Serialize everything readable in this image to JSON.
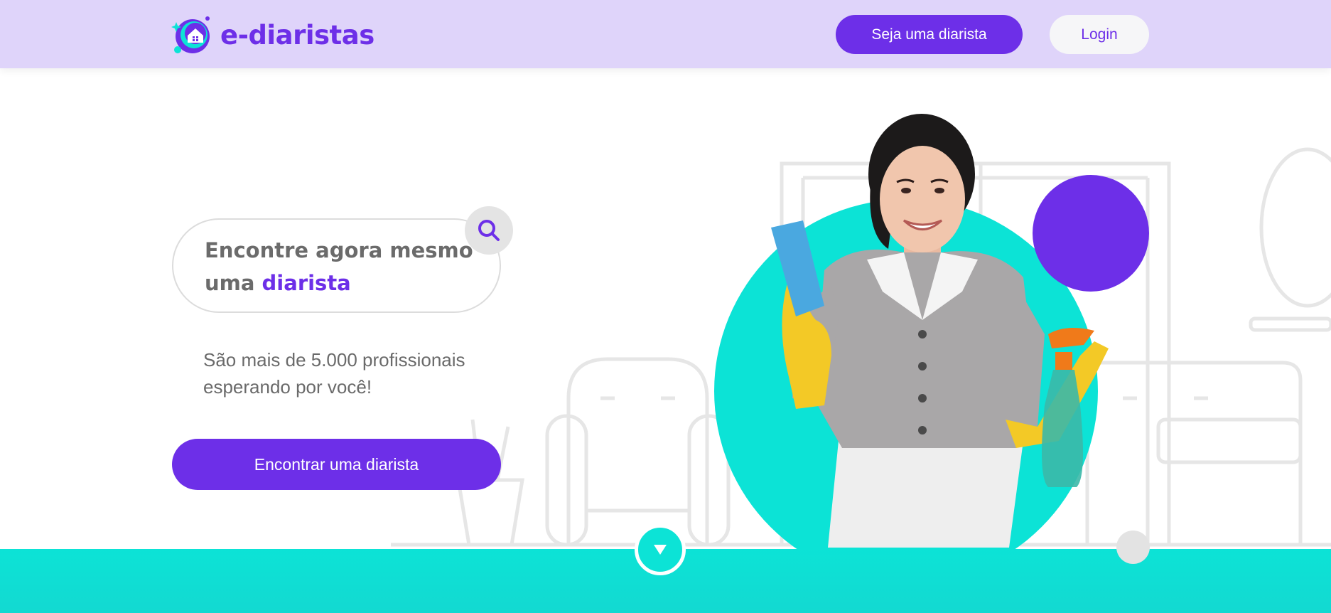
{
  "header": {
    "logo_text": "e-diaristas",
    "logo_icon": "house-cleaning-logo-icon",
    "become_button_label": "Seja uma diarista",
    "login_button_label": "Login"
  },
  "hero": {
    "search_title_prefix": "Encontre agora mesmo uma",
    "search_title_highlight": "diarista",
    "search_icon": "search-icon",
    "subtitle": "São mais de 5.000 profissionais esperando por você!",
    "cta_label": "Encontrar uma diarista",
    "image": "cleaning-lady-photo"
  },
  "scroll_indicator": "chevron-down-icon",
  "colors": {
    "header_bg": "#dfd4fa",
    "brand": "#6d2fe8",
    "teal": "#0ce3d6",
    "text_gray": "#6b6b6b"
  }
}
